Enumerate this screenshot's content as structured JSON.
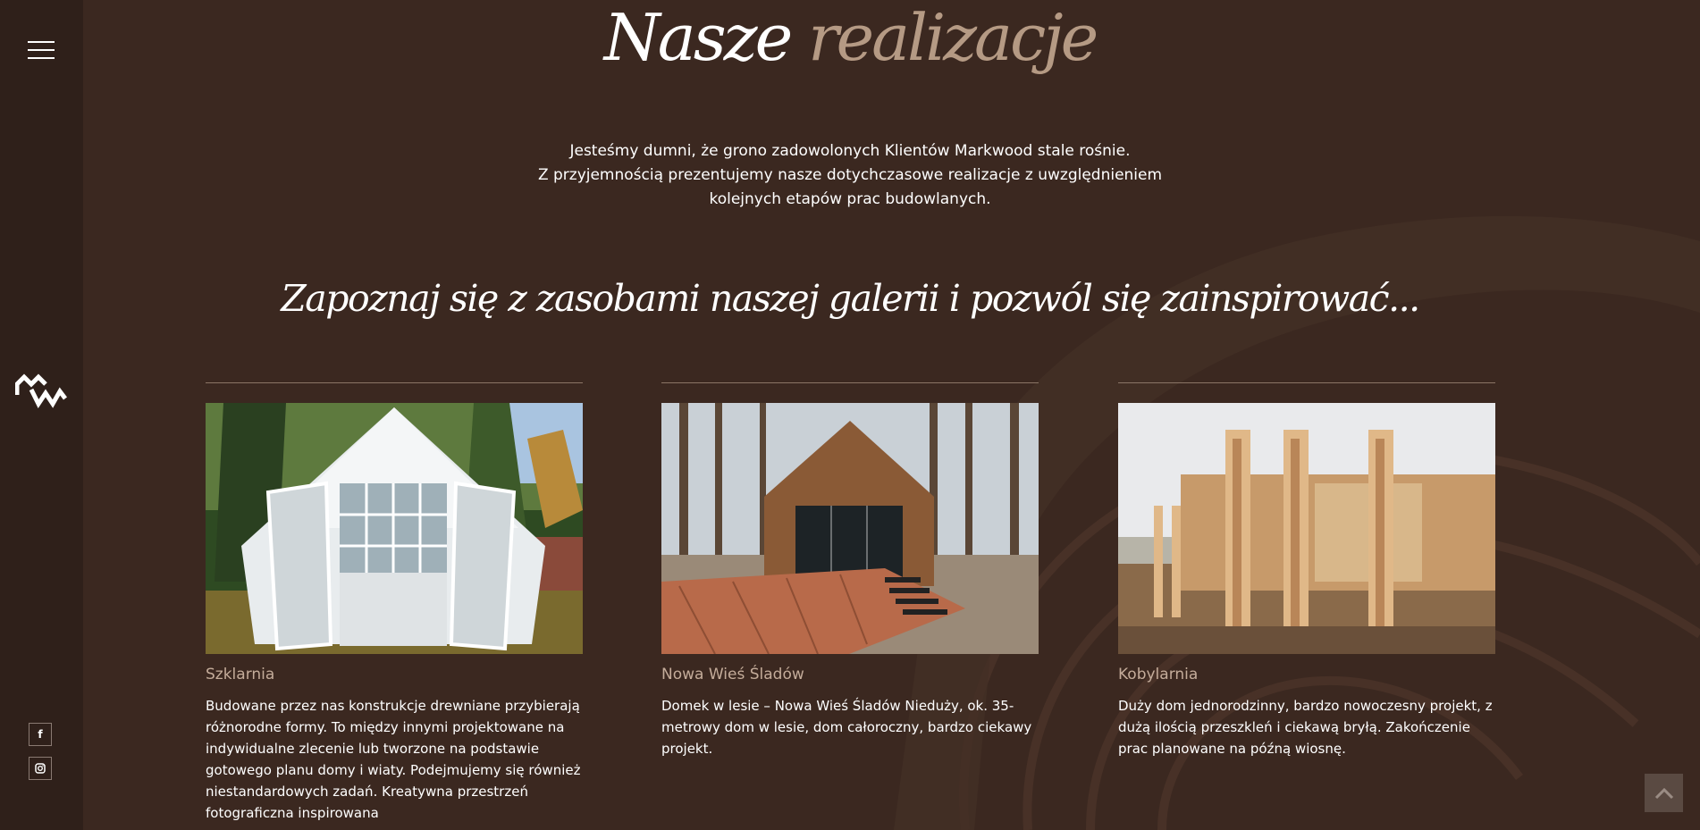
{
  "page": {
    "title_main": "Nasze",
    "title_accent": "realizacje",
    "intro_lines": [
      "Jesteśmy dumni, że grono zadowolonych Klientów Markwood stale rośnie.",
      "Z przyjemnością prezentujemy nasze dotychczasowe realizacje z uwzględnieniem",
      "kolejnych etapów prac budowlanych."
    ],
    "subtitle": "Zapoznaj się z zasobami naszej galerii i pozwól się zainspirować..."
  },
  "sidebar": {
    "menu_icon": "hamburger-menu-icon",
    "logo": "markwood-logo",
    "social": [
      {
        "name": "facebook",
        "glyph": "f"
      },
      {
        "name": "instagram",
        "glyph": "◙"
      }
    ]
  },
  "projects": [
    {
      "name": "Szklarnia",
      "description": "Budowane przez nas konstrukcje drewniane przybierają różnorodne formy. To między innymi projektowane na indywidualne zlecenie lub tworzone na podstawie gotowego planu domy i wiaty. Podejmujemy się również niestandardowych zadań. Kreatywna przestrzeń fotograficzna inspirowana"
    },
    {
      "name": "Nowa Wieś Śladów",
      "description": "Domek w lesie – Nowa Wieś Śladów Nieduży, ok. 35-metrowy dom w lesie, dom całoroczny, bardzo ciekawy projekt."
    },
    {
      "name": "Kobylarnia",
      "description": "Duży dom jednorodzinny, bardzo nowoczesny projekt, z dużą ilością przeszkleń i ciekawą bryłą. Zakończenie prac planowane na późną wiosnę."
    }
  ],
  "colors": {
    "background": "#3b2820",
    "sidebar": "#2f201a",
    "accent": "#b59a84",
    "project_name": "#c4ac9a"
  },
  "scroll_top_icon": "chevron-up-icon"
}
